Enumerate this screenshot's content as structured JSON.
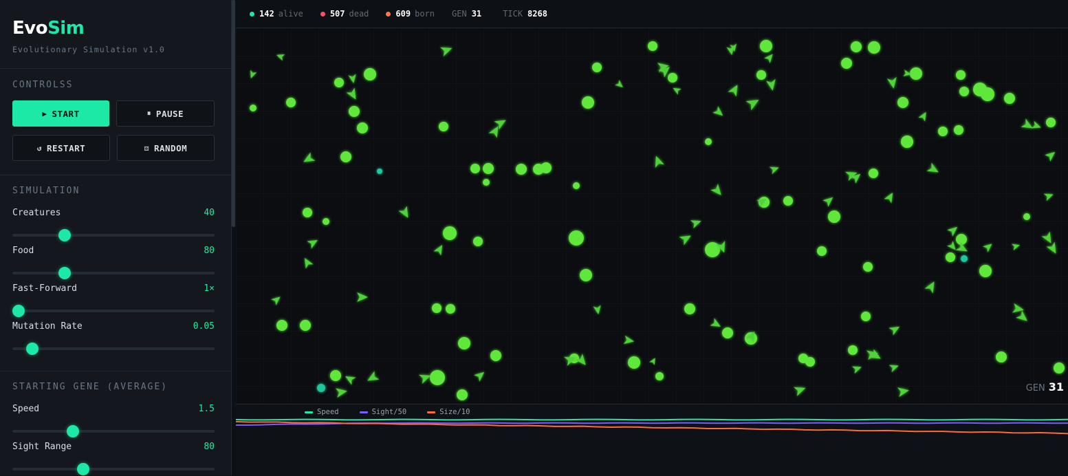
{
  "brand": {
    "name_part1": "Evo",
    "name_part2": "Sim",
    "subtitle": "Evolutionary Simulation v1.0"
  },
  "controls": {
    "title": "CONTROLSS",
    "start": "START",
    "pause": "PAUSE",
    "restart": "RESTART",
    "random": "RANDOM"
  },
  "simulation": {
    "title": "SIMULATION",
    "params": [
      {
        "label": "Creatures",
        "value": "40",
        "fraction": 0.26
      },
      {
        "label": "Food",
        "value": "80",
        "fraction": 0.26
      },
      {
        "label": "Fast-Forward",
        "value": "1×",
        "fraction": 0.03
      },
      {
        "label": "Mutation Rate",
        "value": "0.05",
        "fraction": 0.1
      }
    ]
  },
  "genes": {
    "title": "STARTING GENE (AVERAGE)",
    "params": [
      {
        "label": "Speed",
        "value": "1.5",
        "fraction": 0.3
      },
      {
        "label": "Sight Range",
        "value": "80",
        "fraction": 0.35
      }
    ]
  },
  "stats": {
    "alive": {
      "num": "142",
      "label": "alive",
      "color": "#1de9a6"
    },
    "dead": {
      "num": "507",
      "label": "dead",
      "color": "#ff4d6d"
    },
    "born": {
      "num": "609",
      "label": "born",
      "color": "#ff7a45"
    },
    "gen": {
      "label": "GEN",
      "num": "31"
    },
    "tick": {
      "label": "TICK",
      "num": "8268"
    }
  },
  "world": {
    "gen_label": "GEN",
    "gen_value": "31",
    "food_color": "#5ee83a",
    "creature_color": "#4fd33a",
    "special_color": "#1ec99c"
  },
  "chart": {
    "legend": [
      {
        "name": "Speed",
        "color": "#1de9a6"
      },
      {
        "name": "Sight/50",
        "color": "#7b5cff"
      },
      {
        "name": "Size/10",
        "color": "#ff6a3d"
      }
    ]
  }
}
